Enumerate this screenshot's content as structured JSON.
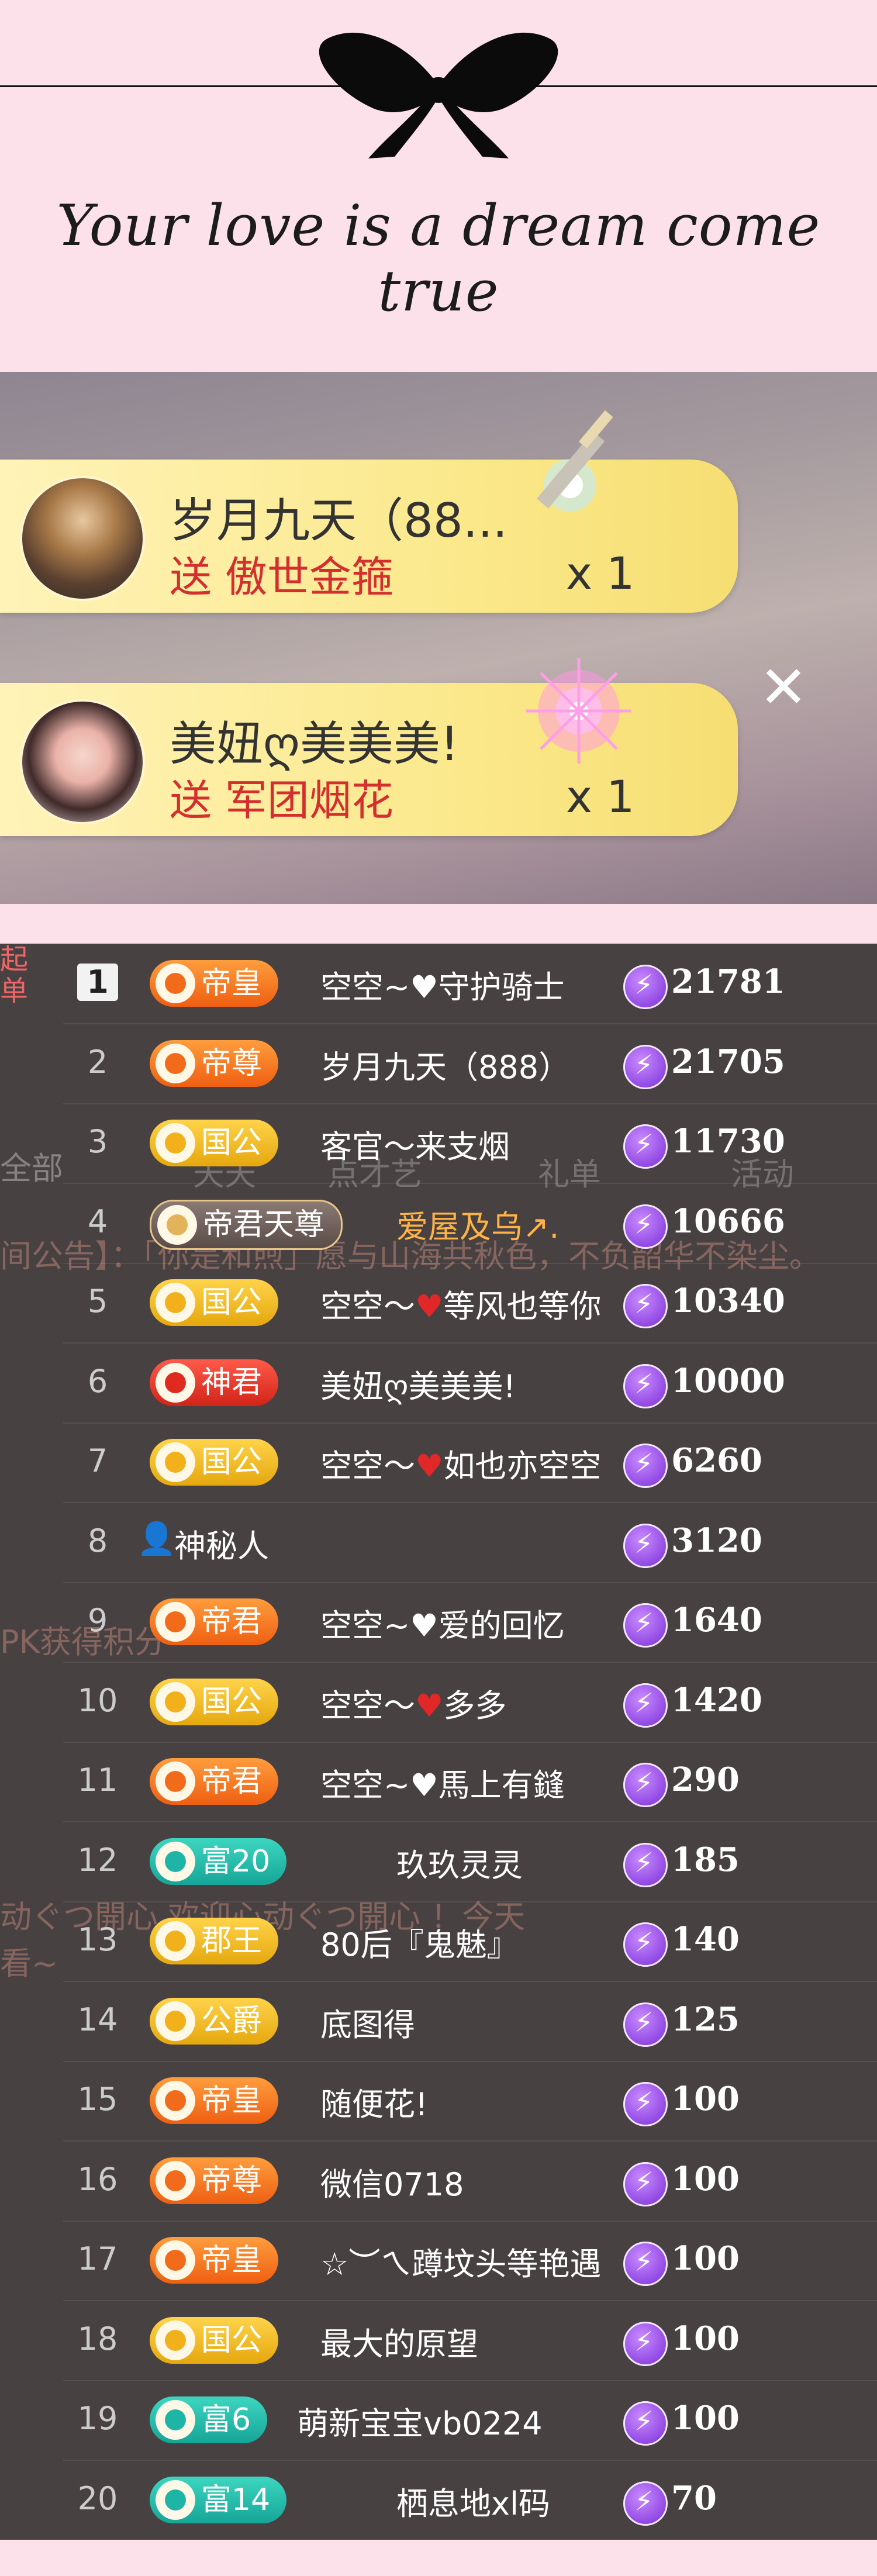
{
  "header": {
    "tagline": "Your love is a dream come true",
    "bow_icon": "bow-icon"
  },
  "gifts": [
    {
      "sender": "岁月九天（88...",
      "send_text": "送 傲世金箍",
      "count": "x 1",
      "icon": "golden-staff-icon"
    },
    {
      "sender": "美妞ღ美美美!",
      "send_text": "送 军团烟花",
      "count": "x 1",
      "icon": "firework-icon"
    }
  ],
  "close_label": "✕",
  "side_tab": "起单",
  "background_chat": {
    "all_label": "全部",
    "announcement": "间公告】：「你是和煦」愿与山海共秋色，不负韶华不染尘。",
    "tabs": [
      "天天",
      "点才艺",
      "礼单",
      "活动"
    ],
    "pk": "PK获得积分",
    "welcome_line": "动ぐつ開心 欢迎心动ぐつ開心 ！今天",
    "tail": "看~"
  },
  "rank": {
    "rows": [
      {
        "rank": "1",
        "badge": "帝皇",
        "badge_color": "orange",
        "name_pre": "空空~",
        "name_mark": "♥",
        "mark_color": "white",
        "name_post": "守护骑士",
        "score": "21781"
      },
      {
        "rank": "2",
        "badge": "帝尊",
        "badge_color": "orange",
        "name_pre": "岁月九天（888）",
        "name_mark": "",
        "mark_color": "",
        "name_post": "",
        "score": "21705"
      },
      {
        "rank": "3",
        "badge": "国公",
        "badge_color": "gold",
        "name_pre": "客官～来支烟",
        "name_mark": "",
        "mark_color": "",
        "name_post": "",
        "score": "11730"
      },
      {
        "rank": "4",
        "badge": "帝君天尊",
        "badge_color": "fancy",
        "name_pre": "爱屋及乌↗.",
        "name_mark": "",
        "mark_color": "",
        "name_post": "",
        "score": "10666"
      },
      {
        "rank": "5",
        "badge": "国公",
        "badge_color": "gold",
        "name_pre": "空空～",
        "name_mark": "♥",
        "mark_color": "red",
        "name_post": "等风也等你",
        "score": "10340"
      },
      {
        "rank": "6",
        "badge": "神君",
        "badge_color": "red",
        "name_pre": "美妞ღ美美美!",
        "name_mark": "",
        "mark_color": "",
        "name_post": "",
        "score": "10000"
      },
      {
        "rank": "7",
        "badge": "国公",
        "badge_color": "gold",
        "name_pre": "空空～",
        "name_mark": "♥",
        "mark_color": "red",
        "name_post": "如也亦空空",
        "score": "6260"
      },
      {
        "rank": "8",
        "badge": "",
        "badge_color": "",
        "name_pre": "神秘人",
        "name_mark": "",
        "mark_color": "",
        "name_post": "",
        "score": "3120"
      },
      {
        "rank": "9",
        "badge": "帝君",
        "badge_color": "orange",
        "name_pre": "空空~",
        "name_mark": "♥",
        "mark_color": "white",
        "name_post": "爱的回忆",
        "score": "1640"
      },
      {
        "rank": "10",
        "badge": "国公",
        "badge_color": "gold",
        "name_pre": "空空～",
        "name_mark": "♥",
        "mark_color": "red",
        "name_post": "多多",
        "score": "1420"
      },
      {
        "rank": "11",
        "badge": "帝君",
        "badge_color": "orange",
        "name_pre": "空空~",
        "name_mark": "♥",
        "mark_color": "white",
        "name_post": "馬上有鏠",
        "score": "290"
      },
      {
        "rank": "12",
        "badge": "富20",
        "badge_color": "teal",
        "name_pre": "玖玖灵灵",
        "name_mark": "",
        "mark_color": "",
        "name_post": "",
        "score": "185"
      },
      {
        "rank": "13",
        "badge": "郡王",
        "badge_color": "gold",
        "name_pre": "80后『鬼魅』",
        "name_mark": "",
        "mark_color": "",
        "name_post": "",
        "score": "140"
      },
      {
        "rank": "14",
        "badge": "公爵",
        "badge_color": "gold",
        "name_pre": "底图得",
        "name_mark": "",
        "mark_color": "",
        "name_post": "",
        "score": "125"
      },
      {
        "rank": "15",
        "badge": "帝皇",
        "badge_color": "orange",
        "name_pre": "随便花!",
        "name_mark": "",
        "mark_color": "",
        "name_post": "",
        "score": "100"
      },
      {
        "rank": "16",
        "badge": "帝尊",
        "badge_color": "orange",
        "name_pre": "微信0718",
        "name_mark": "",
        "mark_color": "",
        "name_post": "",
        "score": "100"
      },
      {
        "rank": "17",
        "badge": "帝皇",
        "badge_color": "orange",
        "name_pre": "☆︶ㄟ蹲坟头等艳遇",
        "name_mark": "",
        "mark_color": "",
        "name_post": "",
        "score": "100"
      },
      {
        "rank": "18",
        "badge": "国公",
        "badge_color": "gold",
        "name_pre": "最大的原望",
        "name_mark": "",
        "mark_color": "",
        "name_post": "",
        "score": "100"
      },
      {
        "rank": "19",
        "badge": "富6",
        "badge_color": "teal",
        "name_pre": "萌新宝宝vb0224",
        "name_mark": "",
        "mark_color": "",
        "name_post": "",
        "score": "100"
      },
      {
        "rank": "20",
        "badge": "富14",
        "badge_color": "teal",
        "name_pre": "栖息地xl码",
        "name_mark": "",
        "mark_color": "",
        "name_post": "",
        "score": "70"
      }
    ]
  }
}
